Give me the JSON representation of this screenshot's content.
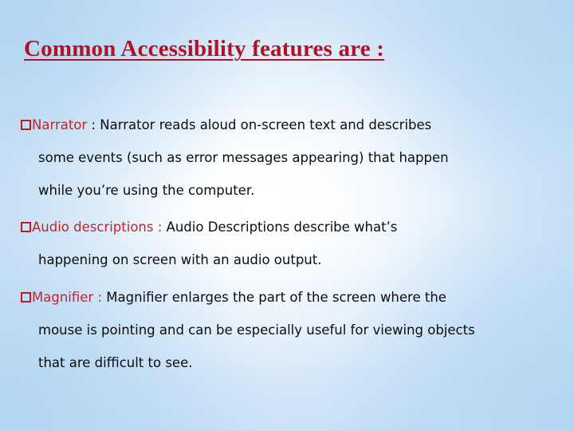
{
  "slide": {
    "title": "Common Accessibility features are :",
    "background": {
      "center_color": "#ffffff",
      "edge_color": "#c7dff5"
    },
    "title_color": "#b11226",
    "term_color": "#c0252b",
    "body_color": "#0d0d0d",
    "bullet_icon": "hollow-square-bullet",
    "bullet_color": "#b22222",
    "items": [
      {
        "term": "Narrator",
        "separator": " : ",
        "separator_in_term_color": false,
        "line1_rest": "Narrator reads aloud on-screen text and describes",
        "line2": "some events (such as error messages appearing) that happen",
        "line3": "while you’re using the computer."
      },
      {
        "term": "Audio descriptions",
        "separator": "  :  ",
        "separator_in_term_color": true,
        "line1_rest": "Audio  Descriptions  describe   what’s",
        "line2": "happening on screen with an audio output.",
        "line3": ""
      },
      {
        "term": "Magnifier",
        "separator": " : ",
        "separator_in_term_color": true,
        "line1_rest": "Magnifier enlarges the part of the screen where the",
        "line2": "mouse is pointing and can be especially useful for viewing objects",
        "line3": "that are difficult to see."
      }
    ]
  }
}
